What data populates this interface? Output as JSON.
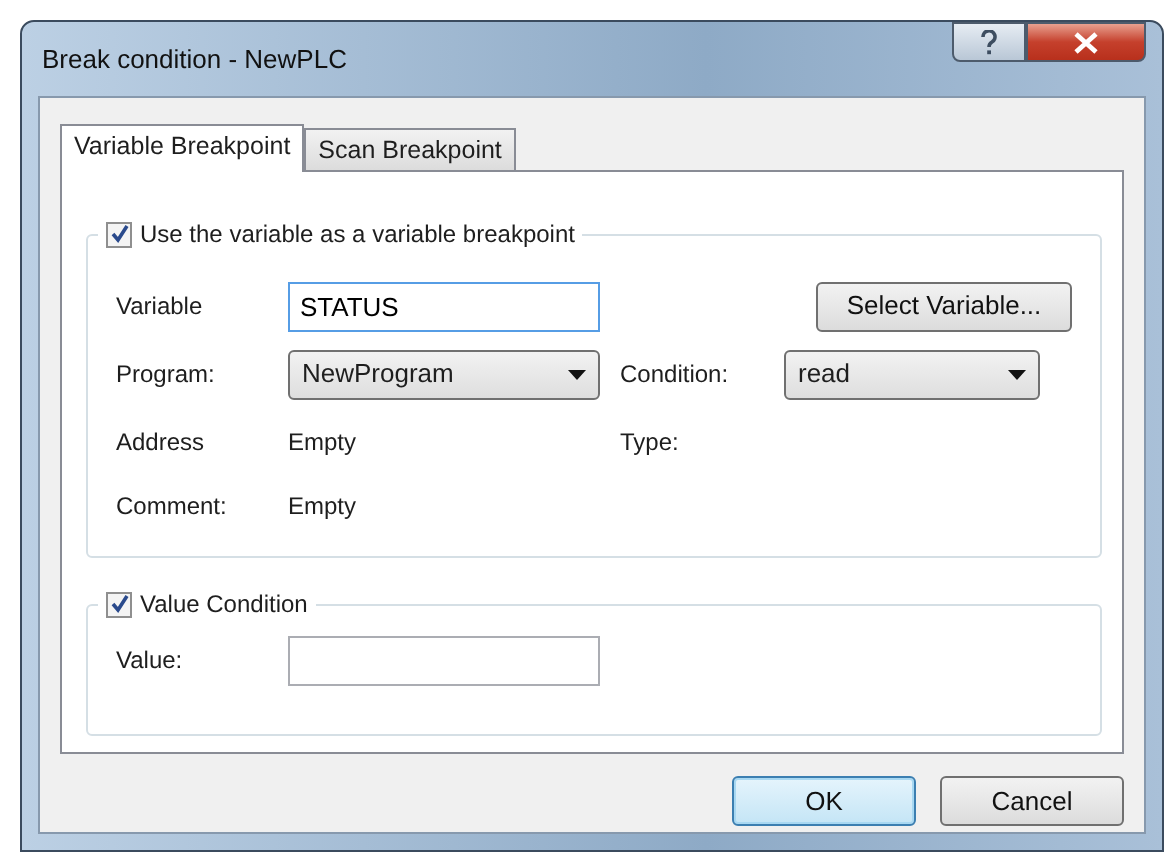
{
  "window": {
    "title": "Break condition - NewPLC"
  },
  "tabs": [
    {
      "label": "Variable Breakpoint",
      "selected": true
    },
    {
      "label": "Scan Breakpoint",
      "selected": false
    }
  ],
  "variable_group": {
    "label": "Use the variable as a variable breakpoint",
    "checked": true,
    "variable": {
      "label": "Variable",
      "value": "STATUS"
    },
    "select_button": "Select Variable...",
    "program": {
      "label": "Program:",
      "value": "NewProgram"
    },
    "condition": {
      "label": "Condition:",
      "value": "read"
    },
    "address": {
      "label": "Address",
      "value": "Empty"
    },
    "type": {
      "label": "Type:"
    },
    "comment": {
      "label": "Comment:",
      "value": "Empty"
    }
  },
  "value_group": {
    "label": "Value Condition",
    "checked": true,
    "value": {
      "label": "Value:"
    }
  },
  "buttons": [
    {
      "label": "OK",
      "kind": "default"
    },
    {
      "label": "Cancel",
      "kind": "normal"
    }
  ]
}
